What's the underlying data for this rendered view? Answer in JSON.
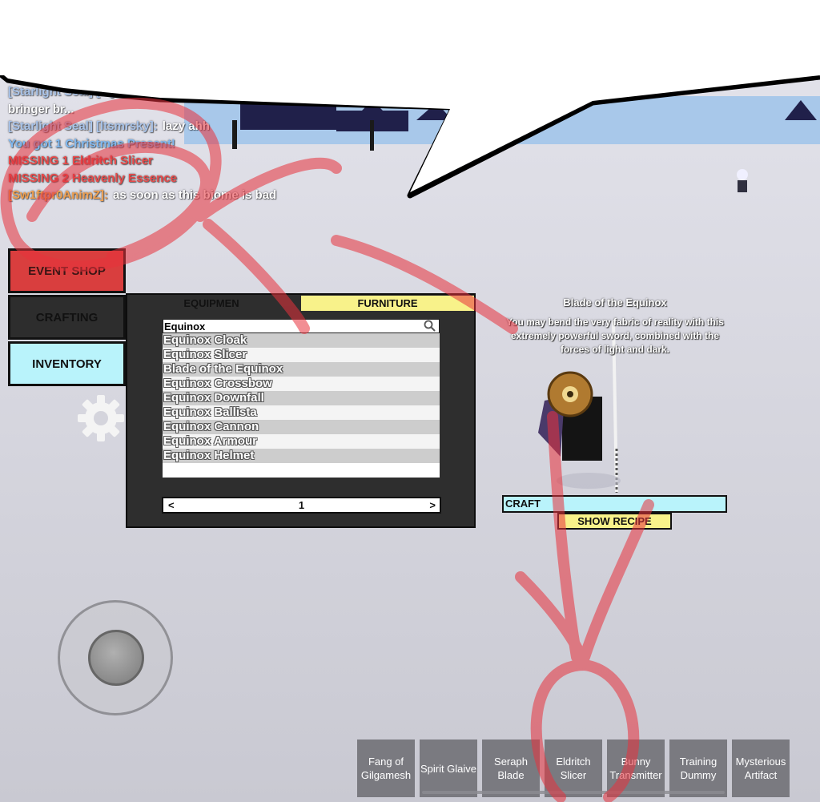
{
  "chat": [
    {
      "speaker": "[Starlight Seal] [...]",
      "message": "",
      "color": "#a9c4ea"
    },
    {
      "speaker": "",
      "message": "bringer br...",
      "color": "#ffffff"
    },
    {
      "speaker": "[Starlight Seal] [ltsmrsky]:",
      "message": "lazy ahh",
      "color": "#a9c4ea"
    },
    {
      "speaker": "",
      "message": "You got 1 Christmas Present!",
      "color": "#7fb8f0"
    },
    {
      "speaker": "",
      "message": "MISSING 1 Eldritch Slicer",
      "color": "#e84a4a"
    },
    {
      "speaker": "",
      "message": "MISSING 2 Heavenly Essence",
      "color": "#e84a4a"
    },
    {
      "speaker": "[Sw1ftpr0AnimZ]:",
      "message": "as soon as this biome is bad",
      "color": "#f0a050"
    }
  ],
  "menu": {
    "event_shop": "EVENT SHOP",
    "crafting": "CRAFTING",
    "inventory": "INVENTORY"
  },
  "panel": {
    "tabs": [
      "EQUIPMEN",
      "FURNITURE"
    ],
    "search_value": "Equinox",
    "items": [
      "Equinox Cloak",
      "Equinox Slicer",
      "Blade of the Equinox",
      "Equinox Crossbow",
      "Equinox Downfall",
      "Equinox Ballista",
      "Equinox Cannon",
      "Equinox Armour",
      "Equinox Helmet"
    ],
    "pager": {
      "prev": "<",
      "page": "1",
      "next": ">"
    }
  },
  "detail": {
    "title": "Blade of the Equinox",
    "description": "You may bend the very fabric of reality with this extremely powerful sword, combined with the forces of light and dark.",
    "craft_label": "CRAFT",
    "recipe_label": "SHOW RECIPE"
  },
  "hotbar": [
    "Fang of Gilgamesh",
    "Spirit Glaive",
    "Seraph Blade",
    "Eldritch Slicer",
    "Bunny Transmitter",
    "Training Dummy",
    "Mysterious Artifact"
  ],
  "icons": {
    "search": "search-icon",
    "settings": "gear-icon",
    "joystick": "joystick-thumb"
  },
  "colors": {
    "event_shop": "#d93e3e",
    "inventory": "#b9f3fb",
    "furniture_tab": "#f8f28a",
    "panel": "#2e2e2e",
    "annotation_red": "#e8323c"
  }
}
